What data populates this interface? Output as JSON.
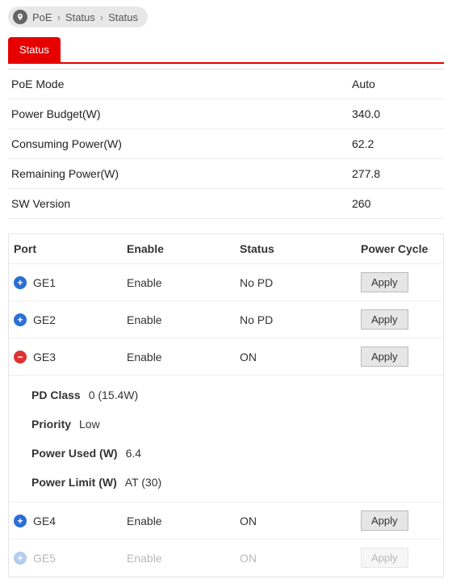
{
  "breadcrumb": {
    "items": [
      "PoE",
      "Status",
      "Status"
    ]
  },
  "tabs": {
    "active": "Status"
  },
  "summary": [
    {
      "label": "PoE Mode",
      "value": "Auto"
    },
    {
      "label": "Power Budget(W)",
      "value": "340.0"
    },
    {
      "label": "Consuming Power(W)",
      "value": "62.2"
    },
    {
      "label": "Remaining Power(W)",
      "value": "277.8"
    },
    {
      "label": "SW Version",
      "value": "260"
    }
  ],
  "port_table": {
    "headers": {
      "port": "Port",
      "enable": "Enable",
      "status": "Status",
      "cycle": "Power Cycle"
    },
    "apply_label": "Apply",
    "rows": [
      {
        "port": "GE1",
        "enable": "Enable",
        "status": "No PD",
        "expand": "plus"
      },
      {
        "port": "GE2",
        "enable": "Enable",
        "status": "No PD",
        "expand": "plus"
      },
      {
        "port": "GE3",
        "enable": "Enable",
        "status": "ON",
        "expand": "minus",
        "detail": {
          "pd_class_label": "PD Class",
          "pd_class_value": "0 (15.4W)",
          "priority_label": "Priority",
          "priority_value": "Low",
          "power_used_label": "Power Used (W)",
          "power_used_value": "6.4",
          "power_limit_label": "Power Limit (W)",
          "power_limit_value": "AT (30)"
        }
      },
      {
        "port": "GE4",
        "enable": "Enable",
        "status": "ON",
        "expand": "plus"
      },
      {
        "port": "GE5",
        "enable": "Enable",
        "status": "ON",
        "expand": "plus",
        "faded": true
      }
    ]
  }
}
